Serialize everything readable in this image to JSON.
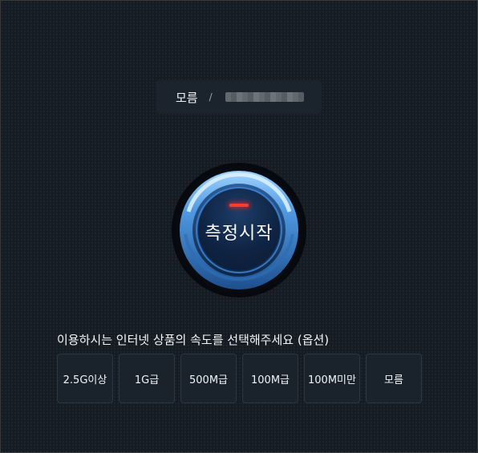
{
  "server": {
    "name": "모름",
    "separator": "/"
  },
  "gauge": {
    "start_label": "측정시작",
    "led_color": "#ff3a2e",
    "ring_color": "#3f86d6"
  },
  "speed_select": {
    "prompt": "이용하시는 인터넷 상품의 속도를 선택해주세요 (옵션)",
    "options": [
      "2.5G이상",
      "1G급",
      "500M급",
      "100M급",
      "100M미만",
      "모름"
    ]
  }
}
